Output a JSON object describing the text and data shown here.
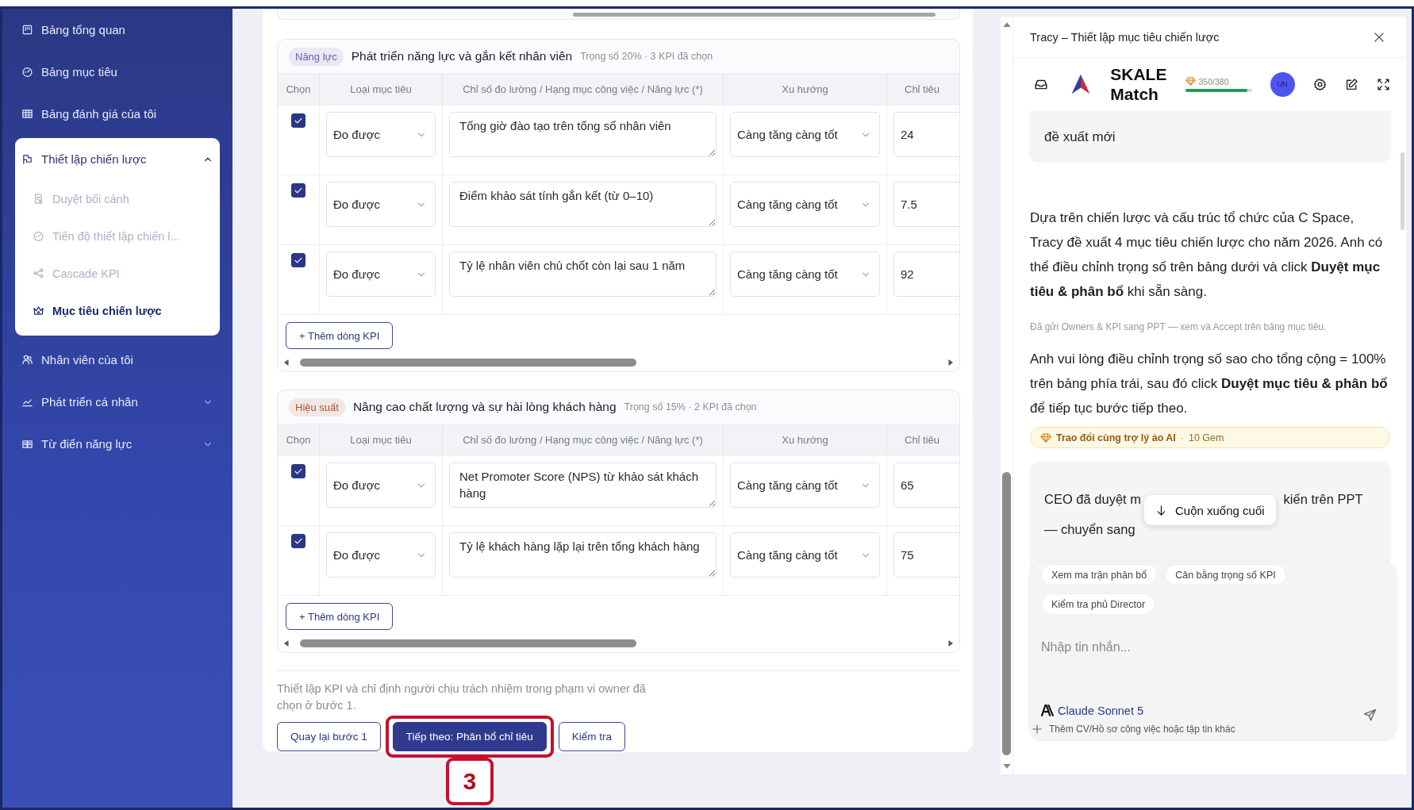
{
  "sidebar": {
    "items": [
      {
        "label": "Bảng tổng quan",
        "selected": false
      },
      {
        "label": "Bảng mục tiêu",
        "selected": false
      },
      {
        "label": "Bảng đánh giá của tôi",
        "selected": false
      },
      {
        "label": "Thiết lập chiến lược",
        "selected": false,
        "expanded": true,
        "children": [
          {
            "label": "Duyệt bối cảnh",
            "selected": false,
            "disabled": true
          },
          {
            "label": "Tiến độ thiết lập chiến l...",
            "selected": false,
            "disabled": true
          },
          {
            "label": "Cascade KPI",
            "selected": false,
            "disabled": true
          },
          {
            "label": "Mục tiêu chiến lược",
            "selected": true,
            "disabled": false
          }
        ]
      },
      {
        "label": "Nhân viên của tôi",
        "selected": false
      },
      {
        "label": "Phát triển cá nhân",
        "selected": false,
        "expanded": false
      },
      {
        "label": "Từ điển năng lực",
        "selected": false,
        "expanded": false
      }
    ]
  },
  "sections": [
    {
      "tag": {
        "label": "Năng lực",
        "color": "#6a5fb0"
      },
      "title": "Phát triển năng lực và gắn kết nhân viên",
      "meta": "Trọng số 20% · 3 KPI đã chọn",
      "columns": [
        "Chọn",
        "Loại mục tiêu",
        "Chỉ số đo lường / Hạng mục công việc / Năng lực (*)",
        "Xu hướng",
        "Chỉ tiêu"
      ],
      "rows": [
        {
          "checked": true,
          "type": "Đo được",
          "metric": "Tổng giờ đào tạo trên tổng số nhân viên",
          "trend": "Càng tăng càng tốt",
          "target": "24"
        },
        {
          "checked": true,
          "type": "Đo được",
          "metric": "Điểm khảo sát tính gắn kết (từ 0–10)",
          "trend": "Càng tăng càng tốt",
          "target": "7.5"
        },
        {
          "checked": true,
          "type": "Đo được",
          "metric": "Tỷ lệ nhân viên chủ chốt còn lại sau 1 năm",
          "trend": "Càng tăng càng tốt",
          "target": "92"
        }
      ],
      "add_button": "+ Thêm dòng KPI"
    },
    {
      "tag": {
        "label": "Hiệu suất",
        "color": "#b0532e"
      },
      "title": "Nâng cao chất lượng và sự hài lòng khách hàng",
      "meta": "Trọng số 15% · 2 KPI đã chọn",
      "columns": [
        "Chọn",
        "Loại mục tiêu",
        "Chỉ số đo lường / Hạng mục công việc / Năng lực (*)",
        "Xu hướng",
        "Chỉ tiêu"
      ],
      "rows": [
        {
          "checked": true,
          "type": "Đo được",
          "metric": "Net Promoter Score (NPS) từ khảo sát khách hàng",
          "trend": "Càng tăng càng tốt",
          "target": "65"
        },
        {
          "checked": true,
          "type": "Đo được",
          "metric": "Tỷ lệ khách hàng lặp lại trên tổng khách hàng",
          "trend": "Càng tăng càng tốt",
          "target": "75"
        }
      ],
      "add_button": "+ Thêm dòng KPI"
    }
  ],
  "footer": {
    "note": "Thiết lập KPI và chỉ định người chịu trách nhiệm trong phạm vi owner đã chọn ở bước 1.",
    "buttons": [
      {
        "label": "Quay lại bước 1",
        "kind": "secondary",
        "highlighted": false
      },
      {
        "label": "Tiếp theo: Phân bổ chỉ tiêu",
        "kind": "primary",
        "highlighted": true,
        "step": "3"
      },
      {
        "label": "Kiểm tra",
        "kind": "secondary",
        "highlighted": false
      }
    ]
  },
  "assistant": {
    "title": "Tracy – Thiết lập mục tiêu chiến lược",
    "brand": "SKALE Match",
    "gems": {
      "reading": "350/380",
      "level": 0.93
    },
    "avatar": "UN",
    "messages": [
      {
        "kind": "bubble",
        "text": "đề xuất mới"
      },
      {
        "kind": "text",
        "text": "Dựa trên chiến lược và cấu trúc tổ chức của C Space, Tracy đề xuất 4 mục tiêu chiến lược cho năm 2026. Anh có thể điều chỉnh trọng số trên bảng dưới và click **Duyệt mục tiêu & phân bổ** khi sẵn sàng."
      },
      {
        "kind": "note",
        "text": "Đã gửi Owners & KPI sang PPT — xem và Accept trên bảng mục tiêu."
      },
      {
        "kind": "text",
        "text": "Anh vui lòng điều chỉnh trọng số sao cho tổng cộng = 100% trên bảng phía trái, sau đó click **Duyệt mục tiêu & phân bổ** để tiếp tục bước tiếp theo."
      },
      {
        "kind": "banner",
        "label": "Trao đổi cùng trợ lý ảo AI",
        "separator": "·",
        "cost": "10 Gem"
      },
      {
        "kind": "covered_bubble",
        "lines": [
          [
            "CEO đã duyệt m",
            "kiến trên PPT"
          ],
          [
            "— chuyển sang"
          ]
        ]
      }
    ],
    "scroll_button": "Cuộn xuống cuối",
    "chips": [
      "Xem ma trận phân bổ",
      "Cân bằng trọng số KPI",
      "Kiểm tra phủ Director"
    ],
    "composer": {
      "placeholder": "Nhập tin nhắn...",
      "model": "Claude Sonnet 5",
      "attach": "Thêm CV/Hồ sơ công việc hoặc tập tin khác"
    }
  }
}
